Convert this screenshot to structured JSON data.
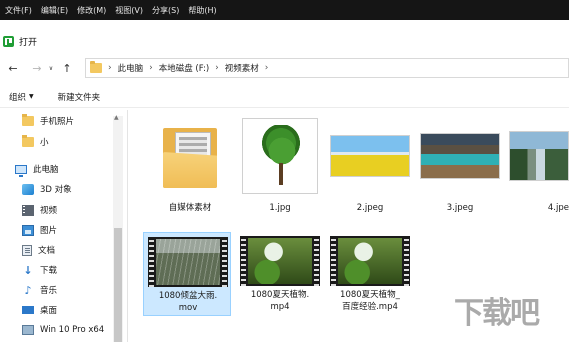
{
  "menu": {
    "items": [
      "文件(F)",
      "编辑(E)",
      "修改(M)",
      "视图(V)",
      "分享(S)",
      "帮助(H)"
    ]
  },
  "dialog": {
    "title": "打开"
  },
  "nav": {
    "back_icon": "arrow-left-icon",
    "forward_icon": "arrow-right-icon",
    "dropdown_icon": "chevron-down-icon",
    "up_icon": "arrow-up-icon"
  },
  "address": {
    "crumbs": [
      "此电脑",
      "本地磁盘 (F:)",
      "视频素材"
    ]
  },
  "toolbar": {
    "organize_label": "组织",
    "new_folder_label": "新建文件夹"
  },
  "sidebar": {
    "items": [
      {
        "label": "手机照片",
        "icon": "folder-icon"
      },
      {
        "label": "小",
        "icon": "folder-icon"
      },
      {
        "label": "此电脑",
        "icon": "computer-icon"
      },
      {
        "label": "3D 对象",
        "icon": "3d-objects-icon"
      },
      {
        "label": "视频",
        "icon": "video-icon"
      },
      {
        "label": "图片",
        "icon": "picture-icon"
      },
      {
        "label": "文档",
        "icon": "document-icon"
      },
      {
        "label": "下载",
        "icon": "download-icon"
      },
      {
        "label": "音乐",
        "icon": "music-icon"
      },
      {
        "label": "桌面",
        "icon": "desktop-icon"
      },
      {
        "label": "Win 10 Pro x64",
        "icon": "drive-icon"
      }
    ]
  },
  "files": [
    {
      "name": "自媒体素材",
      "type": "folder"
    },
    {
      "name": "1.jpg",
      "type": "image"
    },
    {
      "name": "2.jpeg",
      "type": "image"
    },
    {
      "name": "3.jpeg",
      "type": "image"
    },
    {
      "name": "4.jpe",
      "type": "image"
    },
    {
      "name_line1": "1080倾盆大雨.",
      "name_line2": "mov",
      "type": "video",
      "selected": true
    },
    {
      "name_line1": "1080夏天植物.",
      "name_line2": "mp4",
      "type": "video"
    },
    {
      "name_line1": "1080夏天植物_",
      "name_line2": "百度经验.mp4",
      "type": "video"
    }
  ],
  "colors": {
    "menubar_bg": "#151515",
    "selection_bg": "#cce8ff",
    "folder_yellow": "#f3c860",
    "accent_blue": "#2b78c9"
  }
}
